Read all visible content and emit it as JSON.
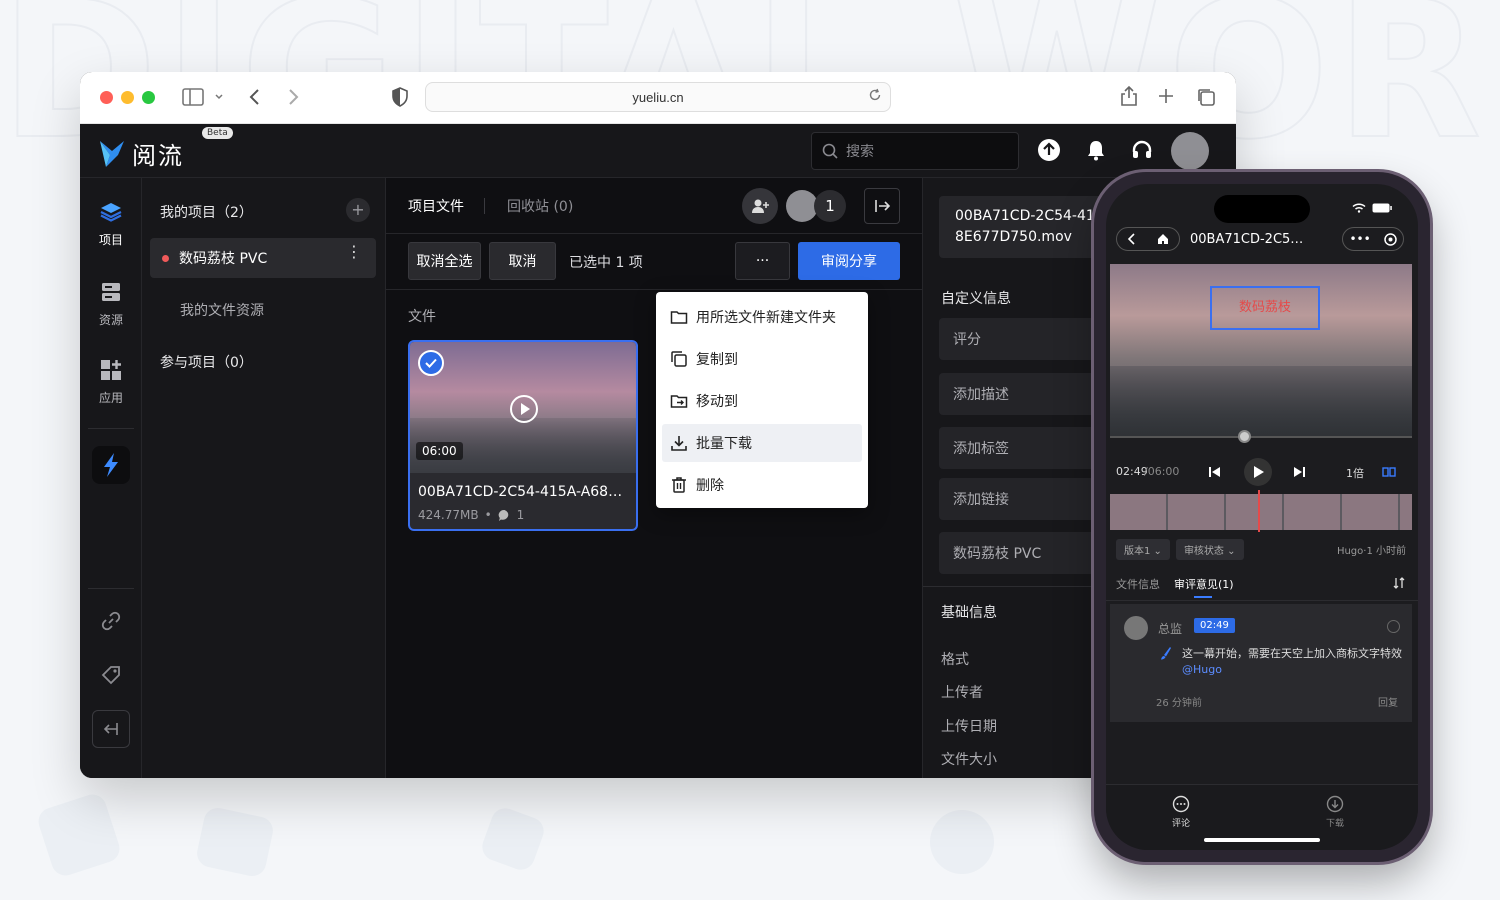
{
  "browser": {
    "url": "yueliu.cn"
  },
  "app": {
    "logo_text": "阅流",
    "beta_badge": "Beta",
    "search_placeholder": "搜索"
  },
  "rail": {
    "items": [
      {
        "label": "项目",
        "icon": "layers-icon"
      },
      {
        "label": "资源",
        "icon": "storage-icon"
      },
      {
        "label": "应用",
        "icon": "apps-icon"
      }
    ]
  },
  "projects": {
    "my_projects": "我的项目（2）",
    "active_project": "数码荔枝 PVC",
    "my_resources": "我的文件资源",
    "joined_projects": "参与项目（0）"
  },
  "main": {
    "tab_files": "项目文件",
    "tab_trash": "回收站 (0)",
    "member_count": "1",
    "deselect_all": "取消全选",
    "cancel": "取消",
    "selected_count": "已选中 1 项",
    "more": "···",
    "review_share": "审阅分享",
    "files_label": "文件",
    "file": {
      "duration": "06:00",
      "name": "00BA71CD-2C54-415A-A68…",
      "size": "424.77MB",
      "comments": "1"
    }
  },
  "context_menu": {
    "items": [
      {
        "label": "用所选文件新建文件夹",
        "icon": "folder-icon"
      },
      {
        "label": "复制到",
        "icon": "copy-icon"
      },
      {
        "label": "移动到",
        "icon": "move-icon"
      },
      {
        "label": "批量下载",
        "icon": "download-icon"
      },
      {
        "label": "删除",
        "icon": "trash-icon"
      }
    ]
  },
  "info": {
    "file_name_1": "00BA71CD-2C54-41",
    "file_name_2": "8E677D750.mov",
    "custom_info": "自定义信息",
    "rating": "评分",
    "add_desc": "添加描述",
    "add_tag": "添加标签",
    "add_link": "添加链接",
    "project": "数码荔枝 PVC",
    "basic_info": "基础信息",
    "format": "格式",
    "uploader": "上传者",
    "upload_date": "上传日期",
    "file_size": "文件大小"
  },
  "phone": {
    "title": "00BA71CD-2C5…",
    "annotation": "数码荔枝",
    "time_current": "02:49",
    "time_total": "/06:00",
    "speed": "1倍",
    "version_chip": "版本1",
    "status_chip": "审核状态",
    "uploader_meta": "Hugo·1 小时前",
    "tab_info": "文件信息",
    "tab_comments": "审评意见(1)",
    "comment": {
      "author": "总监",
      "timestamp": "02:49",
      "text": "这一幕开始，需要在天空上加入商标文字特效",
      "mention": "@Hugo",
      "ago": "26 分钟前",
      "reply": "回复"
    },
    "bottom": {
      "comment_label": "评论",
      "download_label": "下载"
    }
  },
  "colors": {
    "accent": "#2d6be6",
    "rating_star": "#f5a623",
    "active_dot": "#f05a5a"
  }
}
